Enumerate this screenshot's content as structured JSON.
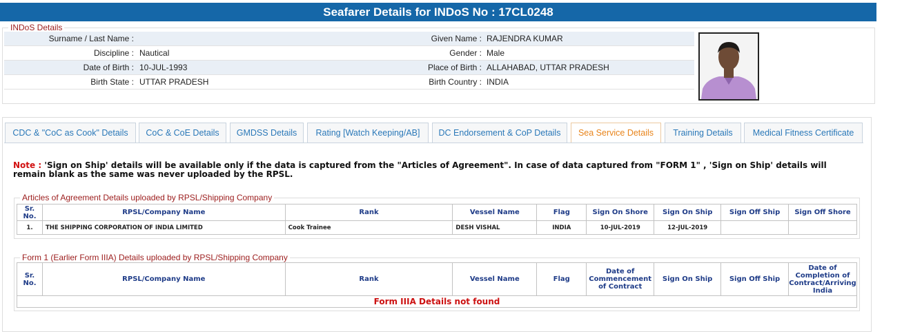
{
  "header": {
    "title": "Seafarer Details for INDoS No : 17CL0248"
  },
  "indos": {
    "legend": "INDoS Details",
    "rows": [
      {
        "l1": "Surname / Last Name :",
        "v1": "",
        "l2": "Given Name :",
        "v2": "RAJENDRA KUMAR"
      },
      {
        "l1": "Discipline :",
        "v1": "Nautical",
        "l2": "Gender :",
        "v2": "Male"
      },
      {
        "l1": "Date of Birth :",
        "v1": "10-JUL-1993",
        "l2": "Place of Birth :",
        "v2": "ALLAHABAD, UTTAR PRADESH"
      },
      {
        "l1": "Birth State :",
        "v1": "UTTAR PRADESH",
        "l2": "Birth Country :",
        "v2": "INDIA"
      }
    ]
  },
  "tabs": [
    {
      "label": "CDC & \"CoC as Cook\" Details"
    },
    {
      "label": "CoC & CoE Details"
    },
    {
      "label": "GMDSS Details"
    },
    {
      "label": "Rating [Watch Keeping/AB]"
    },
    {
      "label": "DC Endorsement & CoP Details"
    },
    {
      "label": "Sea Service Details"
    },
    {
      "label": "Training Details"
    },
    {
      "label": "Medical Fitness Certificate"
    }
  ],
  "active_tab": "Sea Service Details",
  "note": {
    "label": "Note :",
    "text": "'Sign on Ship' details will be available only if the data is captured from the \"Articles of Agreement\". In case of data captured from \"FORM 1\" , 'Sign on Ship' details will remain blank as the same was never uploaded by the RPSL."
  },
  "articles": {
    "legend": "Articles of Agreement Details uploaded by RPSL/Shipping Company",
    "headers": [
      "Sr. No.",
      "RPSL/Company Name",
      "Rank",
      "Vessel Name",
      "Flag",
      "Sign On Shore",
      "Sign On Ship",
      "Sign Off Ship",
      "Sign Off Shore"
    ],
    "rows": [
      [
        "1.",
        "THE SHIPPING CORPORATION OF INDIA LIMITED",
        "Cook Trainee",
        "DESH VISHAL",
        "INDIA",
        "10-JUL-2019",
        "12-JUL-2019",
        "",
        ""
      ]
    ]
  },
  "form1": {
    "legend": "Form 1 (Earlier Form IIIA) Details uploaded by RPSL/Shipping Company",
    "headers": [
      "Sr. No.",
      "RPSL/Company Name",
      "Rank",
      "Vessel Name",
      "Flag",
      "Date of Commencement of Contract",
      "Sign On Ship",
      "Sign Off Ship",
      "Date of Completion of Contract/Arriving India"
    ],
    "not_found": "Form IIIA Details not found"
  },
  "colors": {
    "header_bg": "#1567a8",
    "legend": "#9b1b1b",
    "tab_text": "#2a78b8",
    "active_tab": "#e8841b",
    "note_label": "#d21010",
    "table_header": "#1f3c88"
  }
}
